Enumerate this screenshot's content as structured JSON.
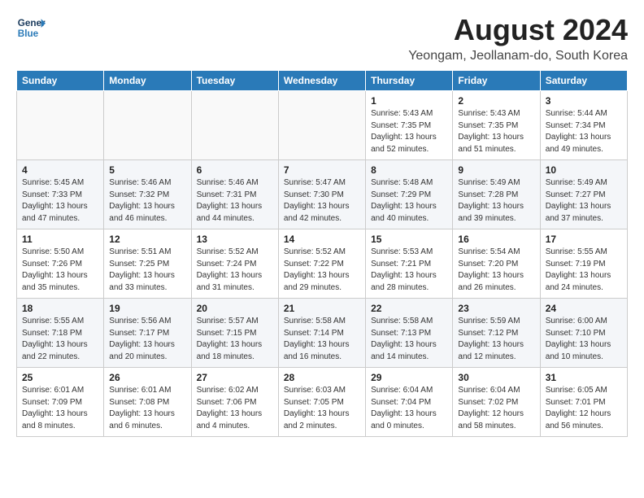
{
  "header": {
    "logo_line1": "General",
    "logo_line2": "Blue",
    "title": "August 2024",
    "subtitle": "Yeongam, Jeollanam-do, South Korea"
  },
  "calendar": {
    "days_of_week": [
      "Sunday",
      "Monday",
      "Tuesday",
      "Wednesday",
      "Thursday",
      "Friday",
      "Saturday"
    ],
    "weeks": [
      [
        {
          "day": "",
          "info": ""
        },
        {
          "day": "",
          "info": ""
        },
        {
          "day": "",
          "info": ""
        },
        {
          "day": "",
          "info": ""
        },
        {
          "day": "1",
          "info": "Sunrise: 5:43 AM\nSunset: 7:35 PM\nDaylight: 13 hours\nand 52 minutes."
        },
        {
          "day": "2",
          "info": "Sunrise: 5:43 AM\nSunset: 7:35 PM\nDaylight: 13 hours\nand 51 minutes."
        },
        {
          "day": "3",
          "info": "Sunrise: 5:44 AM\nSunset: 7:34 PM\nDaylight: 13 hours\nand 49 minutes."
        }
      ],
      [
        {
          "day": "4",
          "info": "Sunrise: 5:45 AM\nSunset: 7:33 PM\nDaylight: 13 hours\nand 47 minutes."
        },
        {
          "day": "5",
          "info": "Sunrise: 5:46 AM\nSunset: 7:32 PM\nDaylight: 13 hours\nand 46 minutes."
        },
        {
          "day": "6",
          "info": "Sunrise: 5:46 AM\nSunset: 7:31 PM\nDaylight: 13 hours\nand 44 minutes."
        },
        {
          "day": "7",
          "info": "Sunrise: 5:47 AM\nSunset: 7:30 PM\nDaylight: 13 hours\nand 42 minutes."
        },
        {
          "day": "8",
          "info": "Sunrise: 5:48 AM\nSunset: 7:29 PM\nDaylight: 13 hours\nand 40 minutes."
        },
        {
          "day": "9",
          "info": "Sunrise: 5:49 AM\nSunset: 7:28 PM\nDaylight: 13 hours\nand 39 minutes."
        },
        {
          "day": "10",
          "info": "Sunrise: 5:49 AM\nSunset: 7:27 PM\nDaylight: 13 hours\nand 37 minutes."
        }
      ],
      [
        {
          "day": "11",
          "info": "Sunrise: 5:50 AM\nSunset: 7:26 PM\nDaylight: 13 hours\nand 35 minutes."
        },
        {
          "day": "12",
          "info": "Sunrise: 5:51 AM\nSunset: 7:25 PM\nDaylight: 13 hours\nand 33 minutes."
        },
        {
          "day": "13",
          "info": "Sunrise: 5:52 AM\nSunset: 7:24 PM\nDaylight: 13 hours\nand 31 minutes."
        },
        {
          "day": "14",
          "info": "Sunrise: 5:52 AM\nSunset: 7:22 PM\nDaylight: 13 hours\nand 29 minutes."
        },
        {
          "day": "15",
          "info": "Sunrise: 5:53 AM\nSunset: 7:21 PM\nDaylight: 13 hours\nand 28 minutes."
        },
        {
          "day": "16",
          "info": "Sunrise: 5:54 AM\nSunset: 7:20 PM\nDaylight: 13 hours\nand 26 minutes."
        },
        {
          "day": "17",
          "info": "Sunrise: 5:55 AM\nSunset: 7:19 PM\nDaylight: 13 hours\nand 24 minutes."
        }
      ],
      [
        {
          "day": "18",
          "info": "Sunrise: 5:55 AM\nSunset: 7:18 PM\nDaylight: 13 hours\nand 22 minutes."
        },
        {
          "day": "19",
          "info": "Sunrise: 5:56 AM\nSunset: 7:17 PM\nDaylight: 13 hours\nand 20 minutes."
        },
        {
          "day": "20",
          "info": "Sunrise: 5:57 AM\nSunset: 7:15 PM\nDaylight: 13 hours\nand 18 minutes."
        },
        {
          "day": "21",
          "info": "Sunrise: 5:58 AM\nSunset: 7:14 PM\nDaylight: 13 hours\nand 16 minutes."
        },
        {
          "day": "22",
          "info": "Sunrise: 5:58 AM\nSunset: 7:13 PM\nDaylight: 13 hours\nand 14 minutes."
        },
        {
          "day": "23",
          "info": "Sunrise: 5:59 AM\nSunset: 7:12 PM\nDaylight: 13 hours\nand 12 minutes."
        },
        {
          "day": "24",
          "info": "Sunrise: 6:00 AM\nSunset: 7:10 PM\nDaylight: 13 hours\nand 10 minutes."
        }
      ],
      [
        {
          "day": "25",
          "info": "Sunrise: 6:01 AM\nSunset: 7:09 PM\nDaylight: 13 hours\nand 8 minutes."
        },
        {
          "day": "26",
          "info": "Sunrise: 6:01 AM\nSunset: 7:08 PM\nDaylight: 13 hours\nand 6 minutes."
        },
        {
          "day": "27",
          "info": "Sunrise: 6:02 AM\nSunset: 7:06 PM\nDaylight: 13 hours\nand 4 minutes."
        },
        {
          "day": "28",
          "info": "Sunrise: 6:03 AM\nSunset: 7:05 PM\nDaylight: 13 hours\nand 2 minutes."
        },
        {
          "day": "29",
          "info": "Sunrise: 6:04 AM\nSunset: 7:04 PM\nDaylight: 13 hours\nand 0 minutes."
        },
        {
          "day": "30",
          "info": "Sunrise: 6:04 AM\nSunset: 7:02 PM\nDaylight: 12 hours\nand 58 minutes."
        },
        {
          "day": "31",
          "info": "Sunrise: 6:05 AM\nSunset: 7:01 PM\nDaylight: 12 hours\nand 56 minutes."
        }
      ]
    ]
  }
}
